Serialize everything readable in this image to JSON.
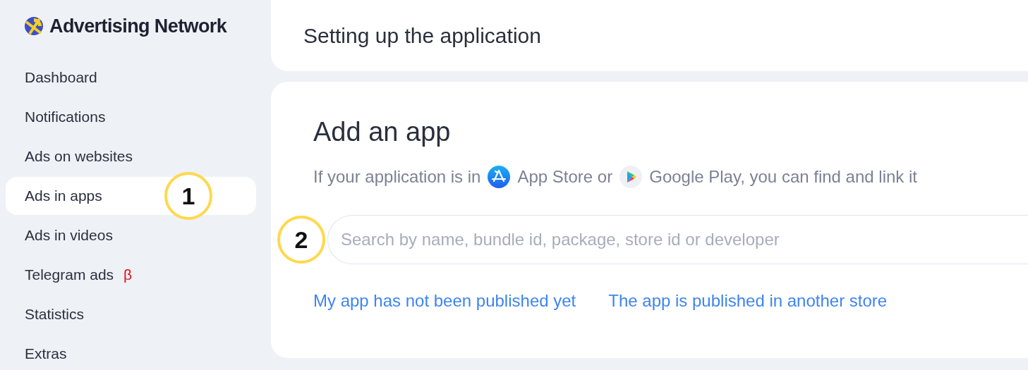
{
  "logo": {
    "text": "Advertising Network"
  },
  "sidebar": {
    "items": [
      {
        "label": "Dashboard",
        "selected": false
      },
      {
        "label": "Notifications",
        "selected": false
      },
      {
        "label": "Ads on websites",
        "selected": false
      },
      {
        "label": "Ads in apps",
        "selected": true,
        "callout": "1"
      },
      {
        "label": "Ads in videos",
        "selected": false
      },
      {
        "label": "Telegram ads",
        "selected": false,
        "badge": "β"
      },
      {
        "label": "Statistics",
        "selected": false
      },
      {
        "label": "Extras",
        "selected": false
      }
    ]
  },
  "header": {
    "title": "Setting up the application"
  },
  "card": {
    "title": "Add an app",
    "hint": [
      {
        "kind": "text",
        "text": "If your application is in"
      },
      {
        "kind": "app_store_icon"
      },
      {
        "kind": "text",
        "text": "App Store or"
      },
      {
        "kind": "google_play_icon"
      },
      {
        "kind": "text",
        "text": "Google Play, you can find and link it"
      }
    ],
    "search": {
      "placeholder": "Search by name, bundle id, package, store id or developer",
      "callout": "2"
    },
    "links": [
      "My app has not been published yet",
      "The app is published in another store"
    ]
  }
}
